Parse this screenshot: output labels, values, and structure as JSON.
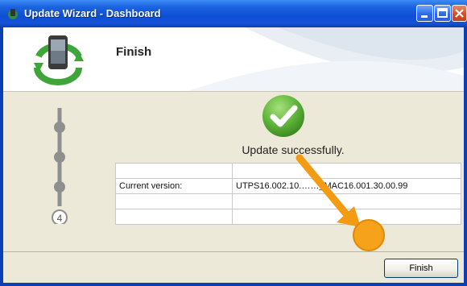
{
  "window": {
    "title": "Update Wizard - Dashboard"
  },
  "header": {
    "title": "Finish"
  },
  "steps": {
    "current_step": "4"
  },
  "status": {
    "message": "Update successfully."
  },
  "info_table": {
    "rows": [
      [
        "",
        ""
      ],
      [
        "Current version:",
        "UTPS16.002.10.……_MAC16.001.30.00.99"
      ],
      [
        "",
        ""
      ],
      [
        "",
        ""
      ]
    ]
  },
  "footer": {
    "finish_label": "Finish"
  },
  "colors": {
    "titlebar": "#1c63e0",
    "success_green": "#5fb53a",
    "annotation_orange": "#f39b12"
  }
}
